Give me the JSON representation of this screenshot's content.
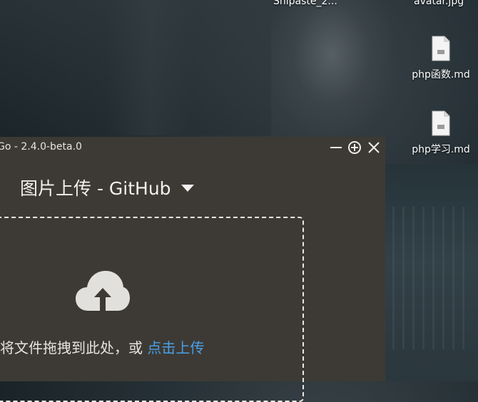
{
  "desktop": {
    "top_labels": [
      "Snipaste_2...",
      "avatar.jpg"
    ],
    "files": [
      {
        "label": "php函数.md",
        "icon": "markdown-file-icon"
      },
      {
        "label": "php学习.md",
        "icon": "markdown-file-icon"
      }
    ]
  },
  "window": {
    "title": "Go - 2.4.0-beta.0",
    "picbed_title": "图片上传 - GitHub",
    "upload_hint": "将文件拖拽到此处，或",
    "upload_link": "点击上传",
    "controls": {
      "minimize": "minimize-icon",
      "pin": "pin-plus-icon",
      "close": "close-icon"
    },
    "colors": {
      "background": "#3d3a35",
      "link": "#4aa0ea"
    }
  }
}
